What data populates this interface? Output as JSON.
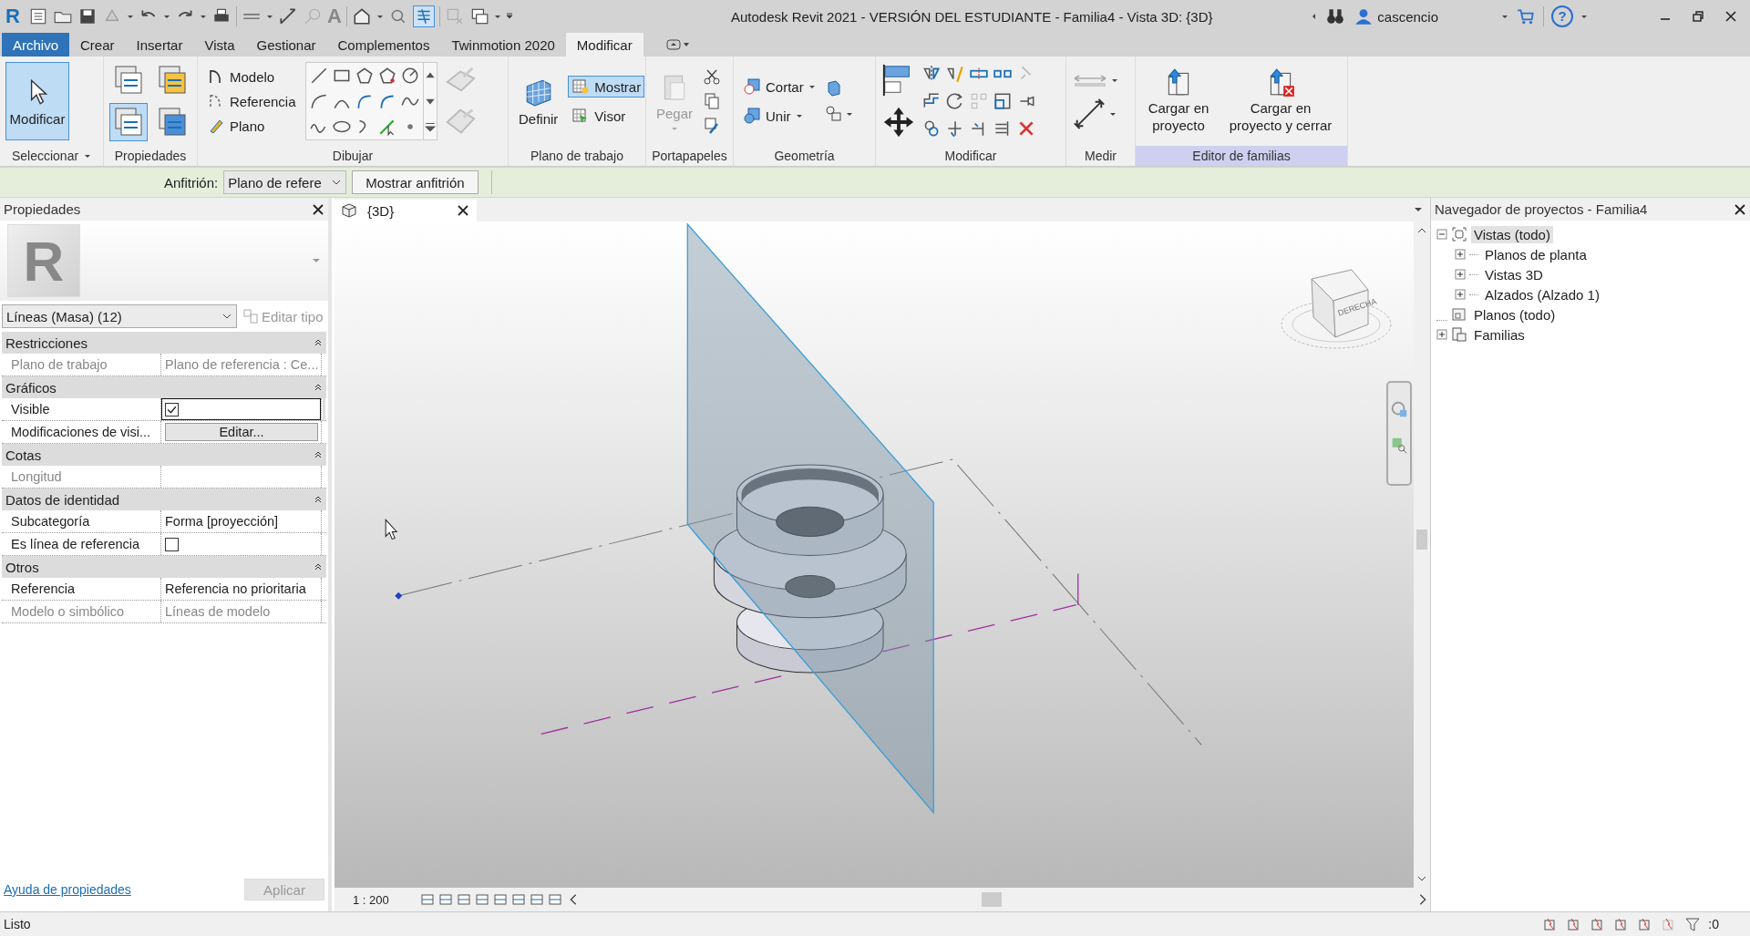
{
  "title_bar": {
    "logo": "R",
    "text_tool_glyph": "A",
    "title": "Autodesk Revit 2021 - VERSIÓN DEL ESTUDIANTE - Familia4 - Vista 3D: {3D}",
    "user": "cascencio",
    "help_glyph": "?"
  },
  "ribbon_tabs": [
    {
      "label": "Archivo",
      "kind": "application",
      "selected": false
    },
    {
      "label": "Crear",
      "kind": "tab",
      "selected": false
    },
    {
      "label": "Insertar",
      "kind": "tab",
      "selected": false
    },
    {
      "label": "Vista",
      "kind": "tab",
      "selected": false
    },
    {
      "label": "Gestionar",
      "kind": "tab",
      "selected": false
    },
    {
      "label": "Complementos",
      "kind": "tab",
      "selected": false
    },
    {
      "label": "Twinmotion 2020",
      "kind": "tab",
      "selected": false
    },
    {
      "label": "Modificar",
      "kind": "tab",
      "selected": true
    }
  ],
  "ribbon_panels": [
    {
      "kind": "select",
      "title": "Seleccionar",
      "has_menu": true,
      "tools": [
        {
          "label": "Modificar",
          "selected": true
        }
      ]
    },
    {
      "kind": "properties",
      "title": "Propiedades",
      "tools": [
        {
          "selected": false
        },
        {
          "selected": false
        },
        {
          "selected": true
        },
        {
          "selected": false
        }
      ]
    },
    {
      "kind": "draw",
      "title": "Dibujar",
      "tools": [
        {
          "label": "Modelo",
          "selected": false
        },
        {
          "label": "Referencia",
          "selected": false
        },
        {
          "label": "Plano",
          "selected": false
        }
      ]
    },
    {
      "kind": "workplane",
      "title": "Plano de trabajo",
      "tools": [
        {
          "label": "Definir",
          "selected": false
        },
        {
          "label": "Mostrar",
          "selected": true
        },
        {
          "label": "Visor",
          "selected": false
        }
      ]
    },
    {
      "kind": "clipboard",
      "title": "Portapapeles",
      "tools": [
        {
          "label": "Pegar",
          "disabled": true
        }
      ]
    },
    {
      "kind": "geometry",
      "title": "Geometría",
      "tools": [
        {
          "label": "Cortar"
        },
        {
          "label": "Unir"
        }
      ]
    },
    {
      "kind": "modify",
      "title": "Modificar"
    },
    {
      "kind": "measure",
      "title": "Medir"
    },
    {
      "kind": "family",
      "title": "Editor de familias",
      "highlighted": true,
      "tools": [
        {
          "label": "Cargar en proyecto"
        },
        {
          "label": "Cargar en proyecto y cerrar"
        }
      ]
    }
  ],
  "options_bar": {
    "host_label": "Anfitrión:",
    "host_value": "Plano de refere",
    "show_host": "Mostrar anfitrión"
  },
  "properties": {
    "title": "Propiedades",
    "preview": "R",
    "type_selector": "Líneas (Masa) (12)",
    "edit_type": {
      "label": "Editar tipo",
      "disabled": true
    },
    "groups": [
      {
        "title": "Restricciones",
        "expanded": true,
        "rows": [
          {
            "label": "Plano de trabajo",
            "kind": "text",
            "value": "Plano de referencia : Ce...",
            "disabled": true,
            "focused": false
          }
        ]
      },
      {
        "title": "Gráficos",
        "expanded": true,
        "rows": [
          {
            "label": "Visible",
            "kind": "checkbox",
            "checked": true,
            "disabled": false,
            "focused": true
          },
          {
            "label": "Modificaciones de visi...",
            "kind": "button",
            "value": "Editar...",
            "disabled": false,
            "focused": false
          }
        ]
      },
      {
        "title": "Cotas",
        "expanded": true,
        "rows": [
          {
            "label": "Longitud",
            "kind": "text",
            "disabled": true,
            "focused": false
          }
        ]
      },
      {
        "title": "Datos de identidad",
        "expanded": true,
        "rows": [
          {
            "label": "Subcategoría",
            "kind": "text",
            "value": "Forma [proyección]",
            "disabled": false,
            "focused": false
          },
          {
            "label": "Es línea de referencia",
            "kind": "checkbox",
            "checked": false,
            "disabled": false,
            "focused": false
          }
        ]
      },
      {
        "title": "Otros",
        "expanded": true,
        "rows": [
          {
            "label": "Referencia",
            "kind": "text",
            "value": "Referencia no prioritaria",
            "disabled": false,
            "focused": false
          },
          {
            "label": "Modelo o simbólico",
            "kind": "text",
            "value": "Líneas de modelo",
            "disabled": true,
            "focused": false
          }
        ]
      }
    ],
    "help_link": "Ayuda de propiedades",
    "apply": {
      "label": "Aplicar",
      "disabled": true
    }
  },
  "view": {
    "tab": "{3D}",
    "viewcube_face": "DERECHA",
    "scale": "1 : 200"
  },
  "browser": {
    "title": "Navegador de proyectos - Familia4",
    "tree": [
      {
        "label": "Vistas (todo)",
        "kind": "views",
        "expanded": true,
        "selected": true,
        "children": [
          {
            "label": "Planos de planta",
            "expanded": false,
            "selected": false
          },
          {
            "label": "Vistas 3D",
            "expanded": false,
            "selected": false
          },
          {
            "label": "Alzados (Alzado 1)",
            "expanded": false,
            "selected": false
          }
        ]
      },
      {
        "label": "Planos (todo)",
        "kind": "sheets",
        "selected": false
      },
      {
        "label": "Familias",
        "kind": "families",
        "expanded": false,
        "selected": false
      }
    ]
  },
  "status_bar": {
    "text": "Listo",
    "filter_count": ":0"
  }
}
